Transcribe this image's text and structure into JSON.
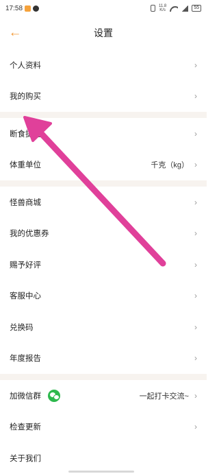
{
  "status_bar": {
    "time": "17:58",
    "net_speed_top": "11.8",
    "net_speed_bottom": "K/s",
    "battery": "55"
  },
  "header": {
    "back_icon": "left-arrow-icon",
    "title": "设置"
  },
  "sections": {
    "account": [
      {
        "label": "个人资料"
      },
      {
        "label": "我的购买"
      }
    ],
    "preferences": [
      {
        "label": "断食提醒"
      },
      {
        "label": "体重单位",
        "value": "千克（kg）"
      }
    ],
    "services": [
      {
        "label": "怪兽商城"
      },
      {
        "label": "我的优惠券"
      },
      {
        "label": "赐予好评"
      },
      {
        "label": "客服中心"
      },
      {
        "label": "兑换码"
      },
      {
        "label": "年度报告"
      }
    ],
    "other": [
      {
        "label": "加微信群",
        "value": "一起打卡交流~"
      },
      {
        "label": "检查更新"
      },
      {
        "label": "关于我们"
      }
    ]
  },
  "colors": {
    "accent": "#f29a38",
    "annotation_arrow": "#e0409a",
    "divider": "#f7f3ef",
    "wechat": "#2db84d"
  },
  "chevron": "›"
}
